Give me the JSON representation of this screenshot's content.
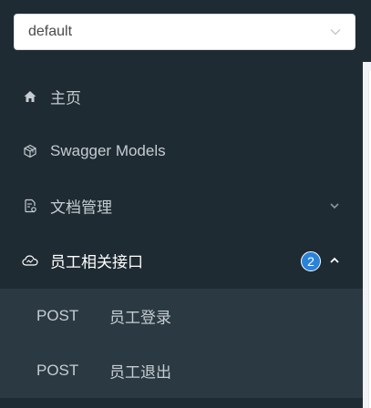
{
  "group_select": {
    "value": "default"
  },
  "menu": {
    "items": [
      {
        "label": "主页",
        "icon": "home-icon"
      },
      {
        "label": "Swagger Models",
        "icon": "cube-icon"
      },
      {
        "label": "文档管理",
        "icon": "document-settings-icon",
        "expanded": false
      },
      {
        "label": "员工相关接口",
        "icon": "cloud-icon",
        "expanded": true,
        "badge": "2"
      }
    ],
    "submenu": [
      {
        "method": "POST",
        "name": "员工登录"
      },
      {
        "method": "POST",
        "name": "员工退出"
      }
    ]
  },
  "colors": {
    "sidebar_bg": "#1f2b32",
    "submenu_bg": "#2b3a42",
    "badge_bg": "#2a83d8",
    "text": "#c5ccd2",
    "active_text": "#ffffff"
  }
}
